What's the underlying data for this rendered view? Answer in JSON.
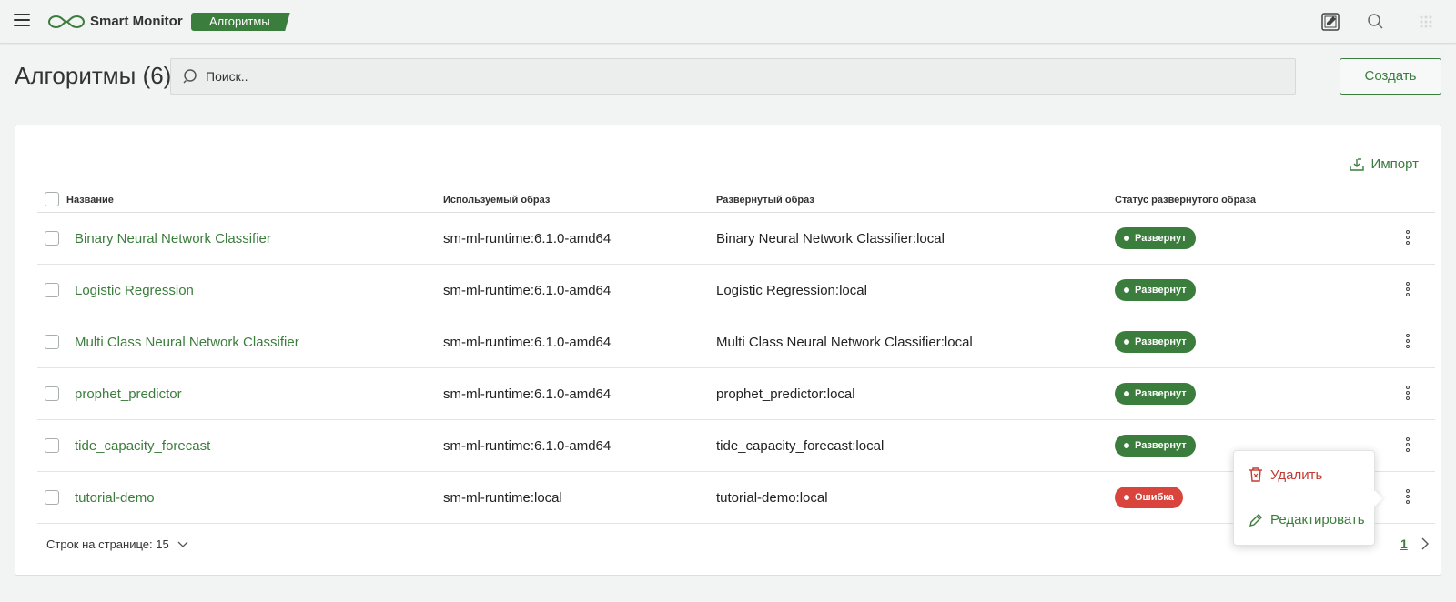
{
  "app": {
    "title": "Smart Monitor",
    "section_badge": "Алгоритмы"
  },
  "page": {
    "title": "Алгоритмы (6)"
  },
  "search": {
    "placeholder": "Поиск.."
  },
  "actions": {
    "create_label": "Создать",
    "import_label": "Импорт"
  },
  "table": {
    "headers": {
      "name": "Название",
      "used_image": "Используемый образ",
      "deployed_image": "Развернутый образ",
      "status": "Статус развернутого образа"
    },
    "rows": [
      {
        "name": "Binary Neural Network Classifier",
        "used_image": "sm-ml-runtime:6.1.0-amd64",
        "deployed_image": "Binary Neural Network Classifier:local",
        "status": "Развернут",
        "status_type": "ok"
      },
      {
        "name": "Logistic Regression",
        "used_image": "sm-ml-runtime:6.1.0-amd64",
        "deployed_image": "Logistic Regression:local",
        "status": "Развернут",
        "status_type": "ok"
      },
      {
        "name": "Multi Class Neural Network Classifier",
        "used_image": "sm-ml-runtime:6.1.0-amd64",
        "deployed_image": "Multi Class Neural Network Classifier:local",
        "status": "Развернут",
        "status_type": "ok"
      },
      {
        "name": "prophet_predictor",
        "used_image": "sm-ml-runtime:6.1.0-amd64",
        "deployed_image": "prophet_predictor:local",
        "status": "Развернут",
        "status_type": "ok"
      },
      {
        "name": "tide_capacity_forecast",
        "used_image": "sm-ml-runtime:6.1.0-amd64",
        "deployed_image": "tide_capacity_forecast:local",
        "status": "Развернут",
        "status_type": "ok"
      },
      {
        "name": "tutorial-demo",
        "used_image": "sm-ml-runtime:local",
        "deployed_image": "tutorial-demo:local",
        "status": "Ошибка",
        "status_type": "err"
      }
    ]
  },
  "pagination": {
    "rows_per_page_label": "Строк на странице: 15",
    "current_page": "1"
  },
  "context_menu": {
    "delete_label": "Удалить",
    "edit_label": "Редактировать"
  },
  "colors": {
    "accent": "#3b7d3c",
    "error": "#d9453d",
    "background": "#f2f3f3"
  },
  "icons": {
    "menu": "hamburger-icon",
    "logo": "infinity-logo-icon",
    "edit": "edit-note-icon",
    "search": "search-icon",
    "apps": "grid-dots-icon",
    "import": "import-icon",
    "delete": "trash-icon",
    "edit_item": "pencil-icon",
    "next": "chevron-right-icon",
    "dropdown": "chevron-down-icon",
    "row_menu": "kebab-icon"
  }
}
